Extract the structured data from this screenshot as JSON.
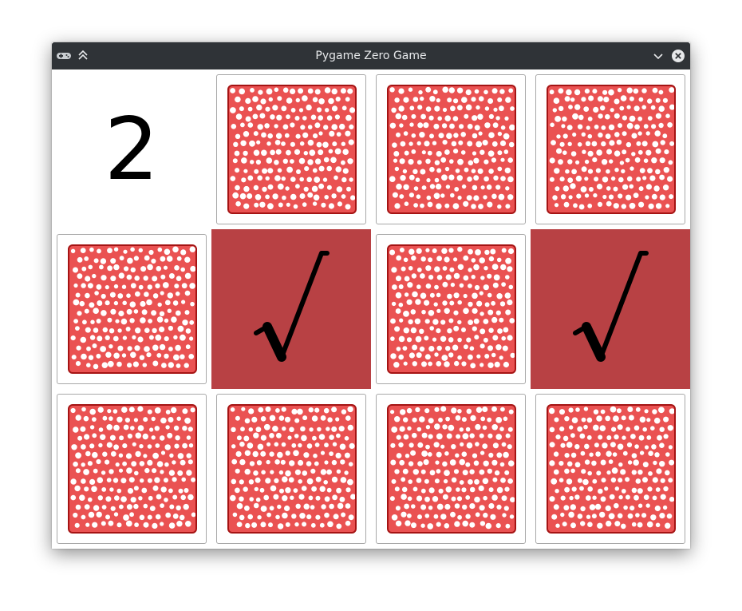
{
  "window": {
    "title": "Pygame Zero Game",
    "app_icon": "gamepad-icon",
    "keep_above_icon": "chevrons-up-icon",
    "minimize_icon": "chevron-down-icon",
    "close_icon": "close-icon"
  },
  "game": {
    "counter": "2",
    "card_back_color": "#ea5252",
    "matched_color": "#b84144",
    "matched_icon": "checkmark-icon",
    "rows": [
      [
        "counter",
        "hidden",
        "hidden",
        "hidden"
      ],
      [
        "hidden",
        "matched",
        "hidden",
        "matched"
      ],
      [
        "hidden",
        "hidden",
        "hidden",
        "hidden"
      ]
    ]
  }
}
